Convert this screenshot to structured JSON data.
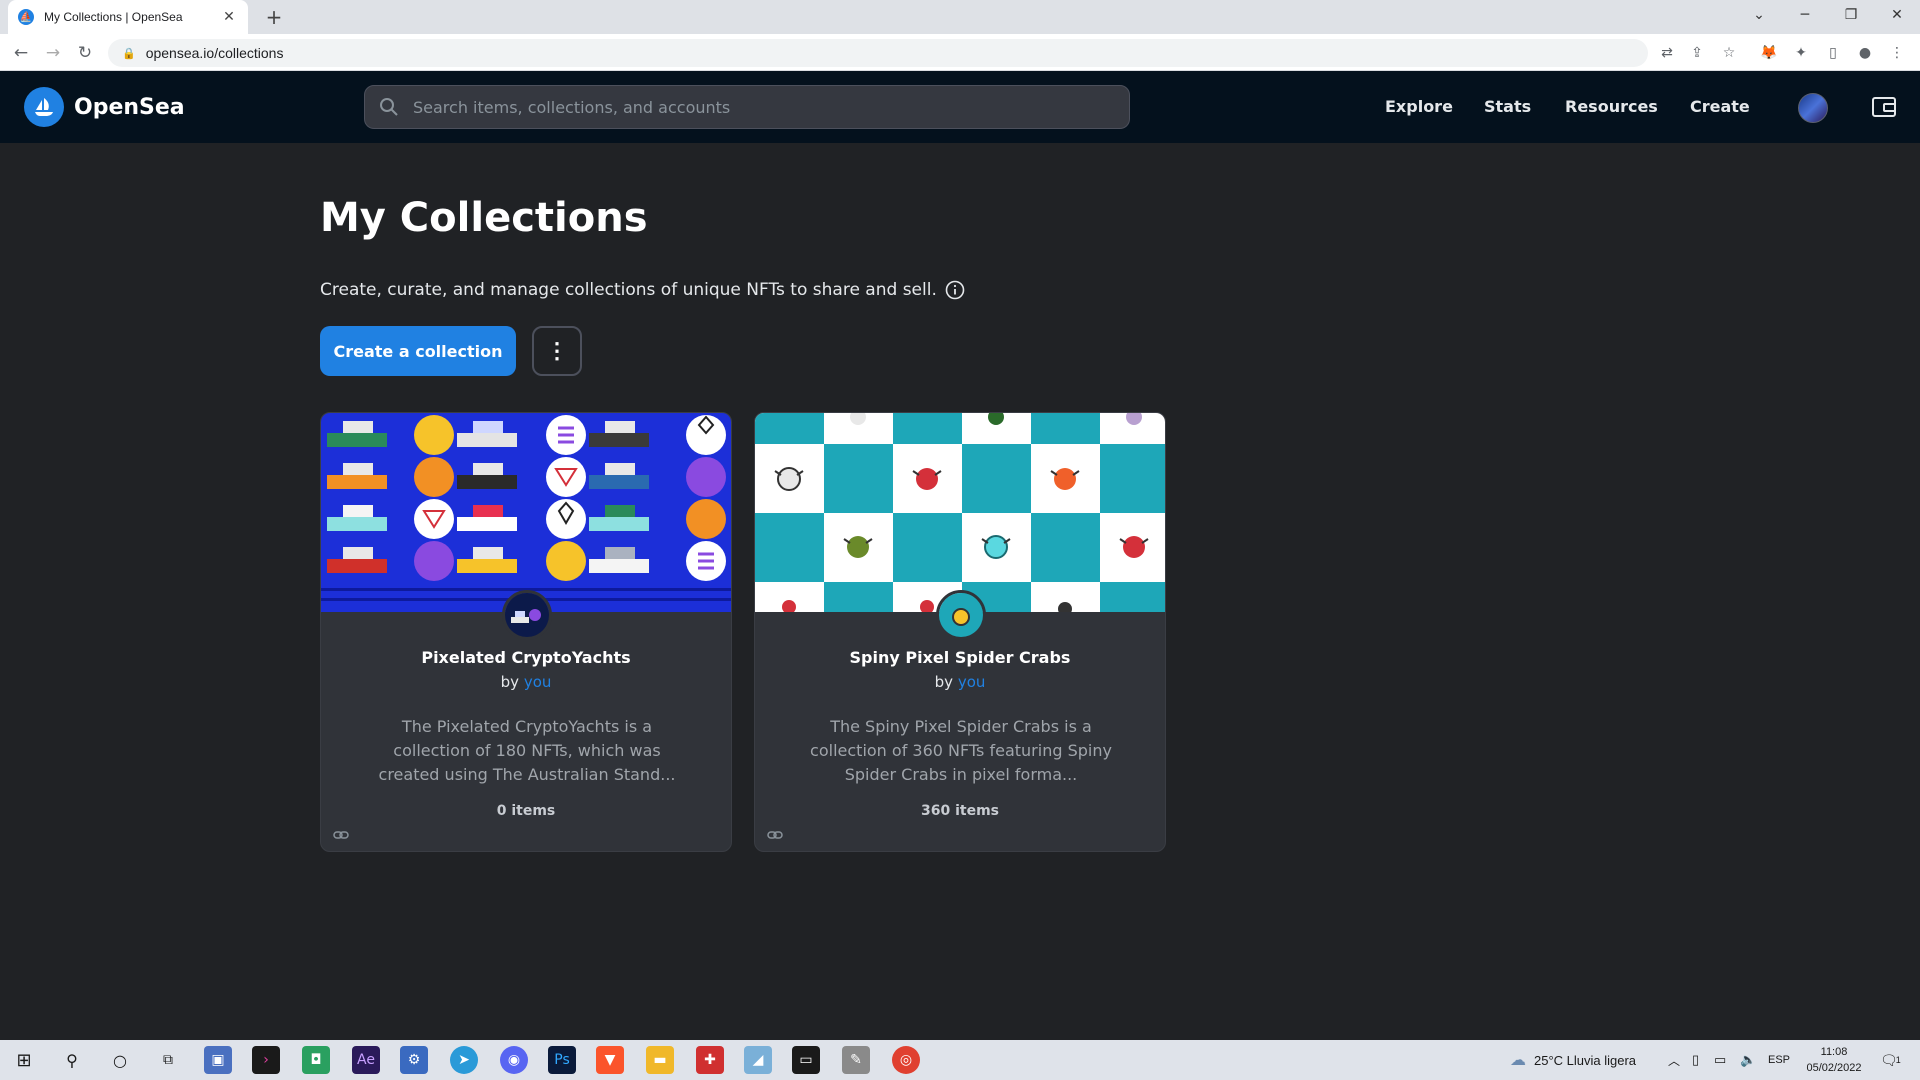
{
  "browser": {
    "tab_title": "My Collections | OpenSea",
    "url": "opensea.io/collections"
  },
  "header": {
    "brand": "OpenSea",
    "search_placeholder": "Search items, collections, and accounts",
    "nav": [
      "Explore",
      "Stats",
      "Resources",
      "Create"
    ]
  },
  "page": {
    "title": "My Collections",
    "subtitle": "Create, curate, and manage collections of unique NFTs to share and sell.",
    "create_button": "Create a collection",
    "more_button": "⋮"
  },
  "collections": [
    {
      "name": "Pixelated CryptoYachts",
      "by_prefix": "by",
      "by_user": "you",
      "description": "The Pixelated CryptoYachts is a collection of 180 NFTs, which was created using The Australian Stand...",
      "items": "0 items"
    },
    {
      "name": "Spiny Pixel Spider Crabs",
      "by_prefix": "by",
      "by_user": "you",
      "description": "The Spiny Pixel Spider Crabs is a collection of 360 NFTs featuring Spiny Spider Crabs in pixel forma...",
      "items": "360 items"
    }
  ],
  "taskbar": {
    "weather": "25°C  Lluvia ligera",
    "language": "ESP",
    "time": "11:08",
    "date": "05/02/2022",
    "notifications": "1"
  },
  "colors": {
    "accent": "#2081e2",
    "header_bg": "#04111d",
    "page_bg": "#202225",
    "card_bg": "#303339"
  }
}
